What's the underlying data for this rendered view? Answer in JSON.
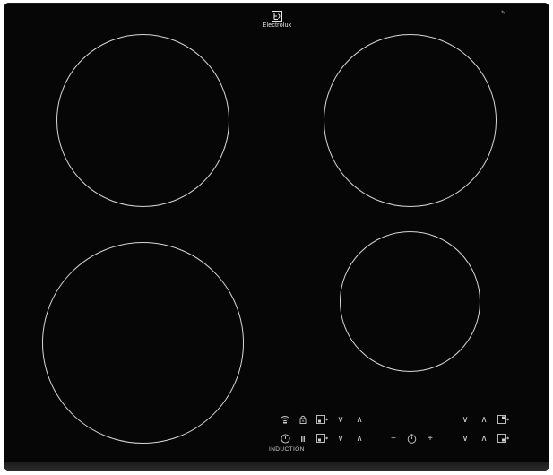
{
  "brand": {
    "name": "Electrolux",
    "logo_icon": "electrolux-logo-icon"
  },
  "serial_marker": "✎",
  "product_label": "INDUCTION",
  "cooking_zones": [
    "front-left",
    "rear-left",
    "rear-right",
    "front-right"
  ],
  "controls": {
    "top_row": {
      "bridge_icon": "bridge-heat-icon",
      "lock_icon": "lock-icon",
      "rear_left_zone_icon": "zone-select-icon",
      "rear_left_minus": "∨",
      "rear_left_plus": "∧",
      "rear_right_minus": "∨",
      "rear_right_plus": "∧",
      "rear_right_zone_icon": "zone-select-icon"
    },
    "bottom_row": {
      "power_icon": "power-icon",
      "pause_symbol": "II",
      "front_left_zone_icon": "zone-select-icon",
      "front_left_minus": "∨",
      "front_left_plus": "∧",
      "timer_minus": "−",
      "timer_icon": "timer-icon",
      "timer_plus": "+",
      "front_right_minus": "∨",
      "front_right_plus": "∧",
      "front_right_zone_icon": "zone-select-icon"
    }
  },
  "colors": {
    "glass": "#060606",
    "print": "#d8d8d8"
  }
}
